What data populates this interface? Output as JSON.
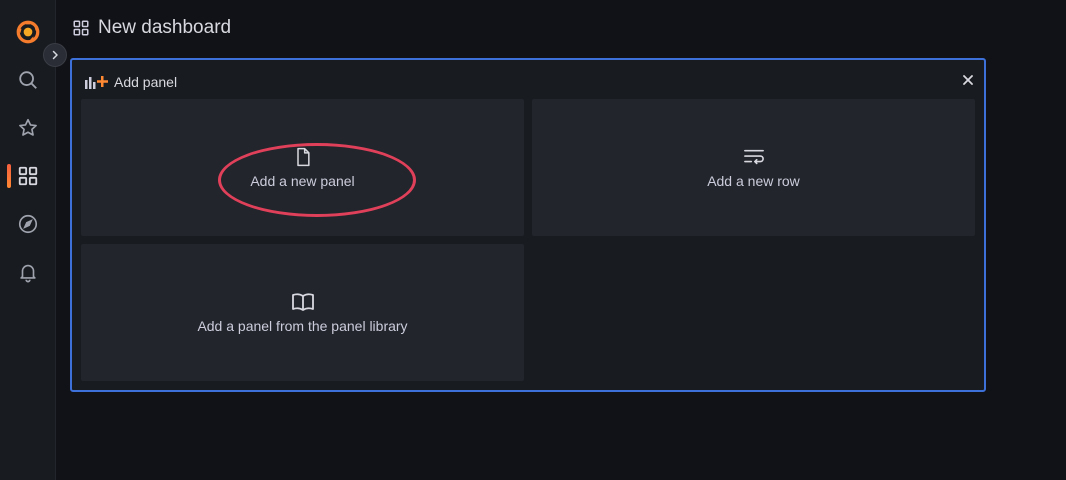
{
  "header": {
    "title": "New dashboard"
  },
  "sidebar": {
    "items": [
      {
        "icon": "grafana-logo-icon"
      },
      {
        "icon": "search-icon"
      },
      {
        "icon": "star-icon"
      },
      {
        "icon": "dashboards-icon",
        "active": true
      },
      {
        "icon": "compass-icon"
      },
      {
        "icon": "bell-icon"
      }
    ],
    "expand_icon": "chevron-right-icon"
  },
  "add_panel": {
    "title": "Add panel",
    "cards": [
      {
        "label": "Add a new panel",
        "icon": "file-icon"
      },
      {
        "label": "Add a new row",
        "icon": "row-icon"
      },
      {
        "label": "Add a panel from the panel library",
        "icon": "book-icon"
      }
    ]
  },
  "colors": {
    "accent": "#3d71d9",
    "active": "#ff8833",
    "annotation": "#e0405a"
  }
}
